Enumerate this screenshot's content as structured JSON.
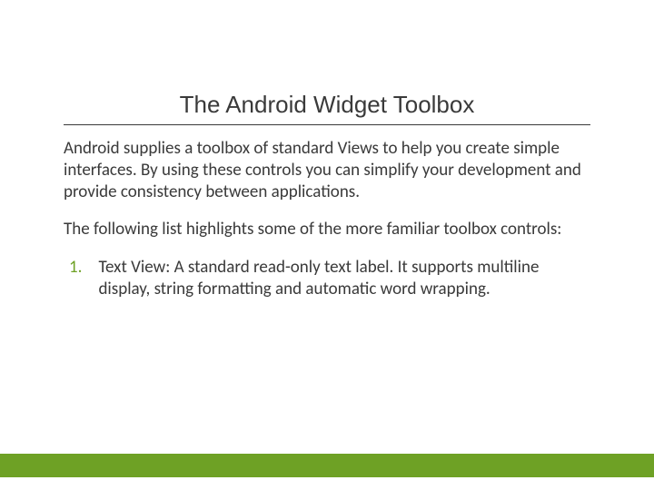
{
  "slide": {
    "title": "The Android Widget Toolbox",
    "para1": "Android supplies a toolbox of standard Views to help you create simple interfaces. By using these controls you can simplify your development and provide consistency between applications.",
    "para2": "The following list highlights some of the more familiar toolbox controls:",
    "list": {
      "item1": {
        "num": "1.",
        "text": " Text View:  A standard read-only text label. It supports multiline display, string formatting and automatic word wrapping."
      }
    }
  }
}
